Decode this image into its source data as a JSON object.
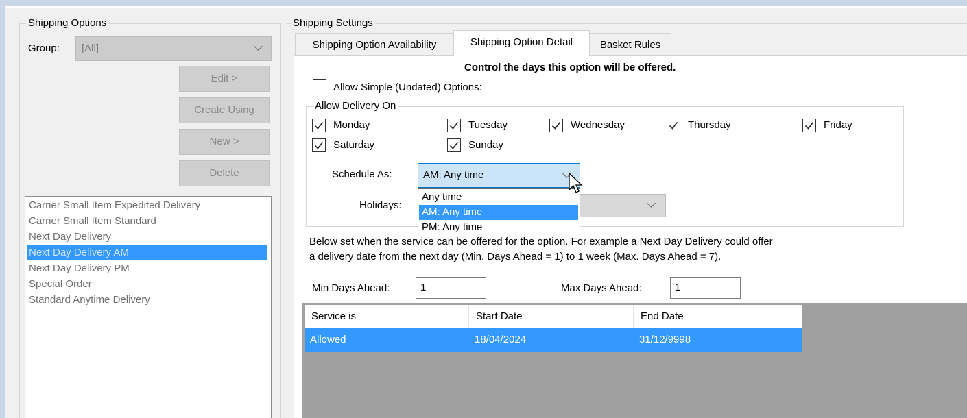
{
  "window": {
    "title_fragment": "Shipping Options"
  },
  "left_panel": {
    "group_title": "Shipping Options",
    "group_label": "Group:",
    "group_value": "[All]",
    "buttons": {
      "edit": "Edit >",
      "create_using": "Create Using",
      "new": "New >",
      "delete": "Delete"
    },
    "list_items": [
      "Carrier Small Item Expedited Delivery",
      "Carrier Small Item Standard",
      "Next Day Delivery",
      "Next Day Delivery AM",
      "Next Day Delivery PM",
      "Special Order",
      "Standard Anytime Delivery"
    ],
    "selected_index": 3
  },
  "right_panel": {
    "group_title": "Shipping Settings",
    "tabs": [
      "Shipping Option Availability",
      "Shipping Option Detail",
      "Basket Rules"
    ],
    "active_tab": 1,
    "heading": "Control the days this option will be offered.",
    "allow_simple": {
      "label": "Allow Simple (Undated) Options:",
      "checked": false
    },
    "delivery_group_title": "Allow Delivery On",
    "days": [
      {
        "label": "Monday",
        "checked": true
      },
      {
        "label": "Tuesday",
        "checked": true
      },
      {
        "label": "Wednesday",
        "checked": true
      },
      {
        "label": "Thursday",
        "checked": true
      },
      {
        "label": "Friday",
        "checked": true
      },
      {
        "label": "Saturday",
        "checked": true
      },
      {
        "label": "Sunday",
        "checked": true
      }
    ],
    "schedule_as": {
      "label": "Schedule As:",
      "value": "AM: Any time",
      "options": [
        "Any time",
        "AM: Any time",
        "PM: Any time"
      ],
      "highlighted_index": 1
    },
    "holidays": {
      "label": "Holidays:",
      "value": ""
    },
    "description_line1_left": "Below set when the",
    "description_line1_hidden": "service can be offered for",
    "description_line1_right": "the option. For example a Next Day Delivery could offer",
    "description_line2": "a delivery date from the next day (Min. Days Ahead = 1) to 1 week (Max. Days Ahead = 7).",
    "min_days": {
      "label": "Min Days Ahead:",
      "value": "1"
    },
    "max_days": {
      "label": "Max Days Ahead:",
      "value": "1"
    },
    "grid": {
      "columns": [
        "Service is",
        "Start Date",
        "End Date"
      ],
      "rows": [
        {
          "service": "Allowed",
          "start": "18/04/2024",
          "end": "31/12/9998"
        }
      ]
    }
  },
  "colors": {
    "selection": "#3399ff",
    "window_bg": "#f0f0f0",
    "grid_bg": "#a0a0a0",
    "active_combo": "#cce4f7",
    "focus_border": "#0078d7"
  }
}
